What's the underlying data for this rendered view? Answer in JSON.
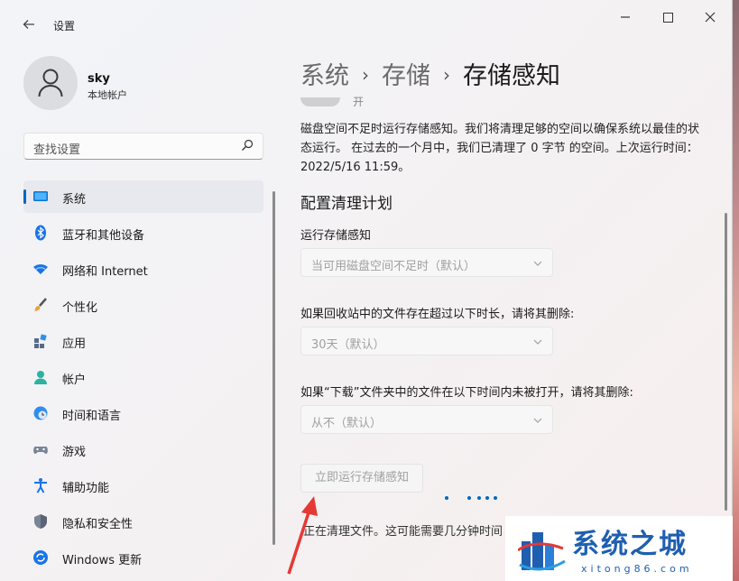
{
  "window": {
    "app_title": "设置",
    "back_icon": "back-arrow-icon",
    "controls": [
      "minimize-icon",
      "maximize-icon",
      "close-icon"
    ]
  },
  "profile": {
    "name": "sky",
    "account_type": "本地帐户"
  },
  "search": {
    "placeholder": "查找设置"
  },
  "sidebar": {
    "items": [
      {
        "label": "系统",
        "icon": "system-monitor-icon",
        "active": true
      },
      {
        "label": "蓝牙和其他设备",
        "icon": "bluetooth-icon",
        "active": false
      },
      {
        "label": "网络和 Internet",
        "icon": "wifi-icon",
        "active": false
      },
      {
        "label": "个性化",
        "icon": "brush-icon",
        "active": false
      },
      {
        "label": "应用",
        "icon": "apps-icon",
        "active": false
      },
      {
        "label": "帐户",
        "icon": "account-icon",
        "active": false
      },
      {
        "label": "时间和语言",
        "icon": "globe-clock-icon",
        "active": false
      },
      {
        "label": "游戏",
        "icon": "gamepad-icon",
        "active": false
      },
      {
        "label": "辅助功能",
        "icon": "accessibility-icon",
        "active": false
      },
      {
        "label": "隐私和安全性",
        "icon": "shield-icon",
        "active": false
      },
      {
        "label": "Windows 更新",
        "icon": "update-icon",
        "active": false
      }
    ]
  },
  "breadcrumb": {
    "items": [
      "系统",
      "存储",
      "存储感知"
    ],
    "separator": "›"
  },
  "main": {
    "toggle_label": "开",
    "description": "磁盘空间不足时运行存储感知。我们将清理足够的空间以确保系统以最佳的状态运行。 在过去的一个月中，我们已清理了 0 字节 的空间。上次运行时间：2022/5/16 11:59。",
    "section_title": "配置清理计划",
    "run_label": "运行存储感知",
    "run_value": "当可用磁盘空间不足时（默认）",
    "recycle_label": "如果回收站中的文件存在超过以下时长，请将其删除:",
    "recycle_value": "30天（默认）",
    "downloads_label": "如果“下载”文件夹中的文件在以下时间内未被打开，请将其删除:",
    "downloads_value": "从不（默认）",
    "run_now_button": "立即运行存储感知",
    "status_text": "正在清理文件。这可能需要几分钟时间"
  },
  "watermark": {
    "title": "系统之城",
    "url": "xitong86.com"
  },
  "colors": {
    "accent": "#0067c0",
    "annotation_arrow": "#e53935",
    "watermark_blue": "#1f5fb0"
  }
}
